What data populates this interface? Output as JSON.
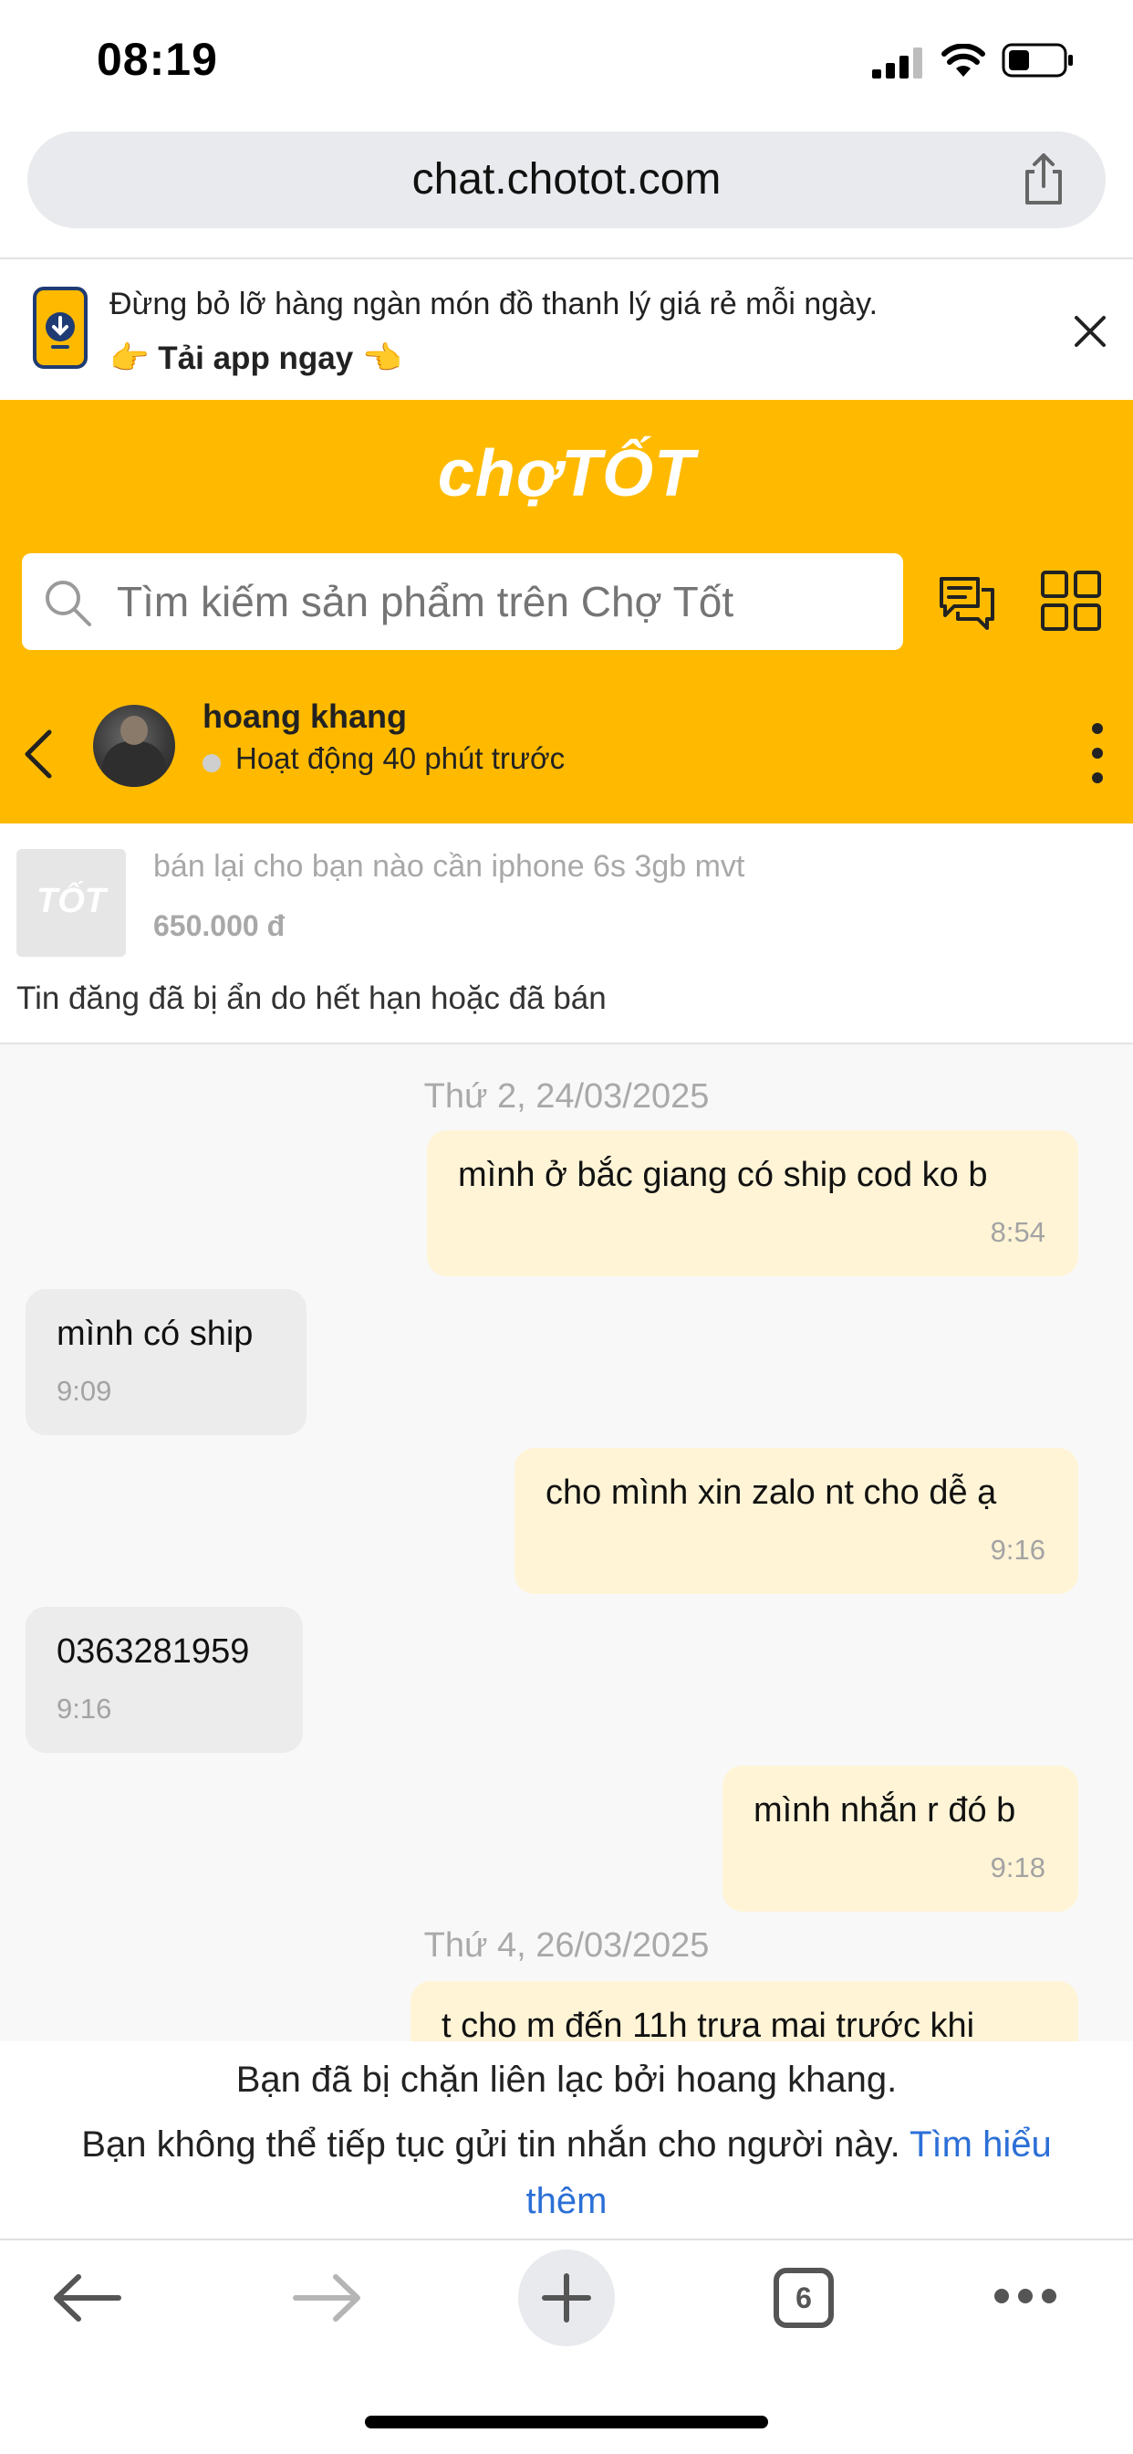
{
  "status_bar": {
    "time": "08:19"
  },
  "browser": {
    "url": "chat.chotot.com",
    "tab_count": "6"
  },
  "app_banner": {
    "line1": "Đừng bỏ lỡ hàng ngàn món đồ thanh lý giá rẻ mỗi ngày.",
    "line2": "👉 Tải app ngay 👈"
  },
  "header": {
    "logo": "chợTỐT",
    "search_placeholder": "Tìm kiếm sản phẩm trên Chợ Tốt"
  },
  "seller": {
    "name": "hoang khang",
    "status": "Hoạt động 40 phút trước"
  },
  "listing": {
    "thumb_logo": "TỐT",
    "title": "bán lại cho bạn nào cần iphone 6s 3gb mvt",
    "price": "650.000 đ",
    "note": "Tin đăng đã bị ẩn do hết hạn hoặc đã bán"
  },
  "chat": {
    "dates": [
      "Thứ 2, 24/03/2025",
      "Thứ 4, 26/03/2025"
    ],
    "messages": [
      {
        "side": "out",
        "text": "mình ở bắc giang có ship cod ko b",
        "time": "8:54"
      },
      {
        "side": "in",
        "text": "mình có ship",
        "time": "9:09"
      },
      {
        "side": "out",
        "text": "cho mình xin zalo nt cho dễ ạ",
        "time": "9:16"
      },
      {
        "side": "in",
        "text": "0363281959",
        "time": "9:16"
      },
      {
        "side": "out",
        "text": "mình nhắn r đó b",
        "time": "9:18"
      },
      {
        "side": "out",
        "text": "t cho m đến 11h trưa mai trước khi",
        "time": ""
      }
    ]
  },
  "blocked_notice": {
    "line1": "Bạn đã bị chặn liên lạc bởi hoang khang.",
    "line2": "Bạn không thể tiếp tục gửi tin nhắn cho người này.",
    "link": "Tìm hiểu thêm"
  },
  "colors": {
    "brand_yellow": "#ffba00",
    "outgoing_bubble": "#fff4d6",
    "incoming_bubble": "#ececec",
    "link": "#2b6fd6"
  }
}
